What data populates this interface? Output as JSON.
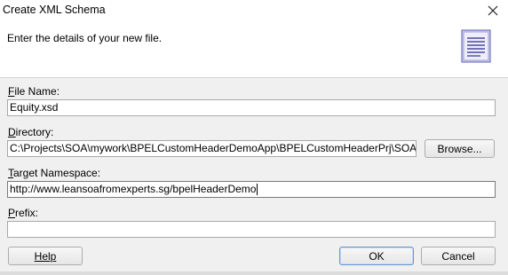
{
  "window": {
    "title": "Create XML Schema",
    "close_icon": "close-icon"
  },
  "header": {
    "text": "Enter the details of your new file.",
    "icon": "document-icon"
  },
  "fields": {
    "file_name": {
      "label_mnemonic": "F",
      "label_rest": "ile Name:",
      "value": "Equity.xsd"
    },
    "directory": {
      "label_mnemonic": "D",
      "label_rest": "irectory:",
      "value": "C:\\Projects\\SOA\\mywork\\BPELCustomHeaderDemoApp\\BPELCustomHeaderPrj\\SOA\\Schemas"
    },
    "target_namespace": {
      "label_mnemonic": "T",
      "label_rest": "arget Namespace:",
      "value": "http://www.leansoafromexperts.sg/bpelHeaderDemo"
    },
    "prefix": {
      "label_mnemonic": "P",
      "label_rest": "refix:",
      "value": ""
    }
  },
  "buttons": {
    "browse": "Browse...",
    "help": "Help",
    "ok": "OK",
    "cancel": "Cancel"
  },
  "colors": {
    "dialog_bg": "#f0f0f0",
    "header_bg": "#ffffff",
    "default_button_border": "#6d96c8",
    "icon_accent": "#5a5ab4"
  }
}
